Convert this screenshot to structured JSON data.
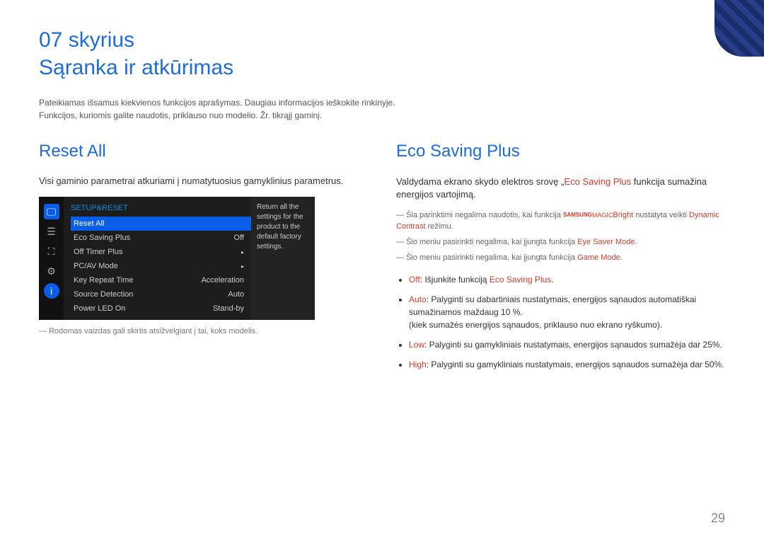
{
  "chapter": "07 skyrius",
  "title": "Sąranka ir atkūrimas",
  "intro1": "Pateikiamas išsamus kiekvienos funkcijos aprašymas. Daugiau informacijos ieškokite rinkinyje.",
  "intro2": "Funkcijos, kuriomis galite naudotis, priklauso nuo modelio. Žr. tikrąjį gaminį.",
  "reset": {
    "heading": "Reset All",
    "desc": "Visi gaminio parametrai atkuriami į numatytuosius gamyklinius parametrus.",
    "menuHeader": "SETUP&RESET",
    "items": [
      {
        "label": "Reset All",
        "value": ""
      },
      {
        "label": "Eco Saving Plus",
        "value": "Off"
      },
      {
        "label": "Off Timer Plus",
        "value": "▸"
      },
      {
        "label": "PC/AV Mode",
        "value": "▸"
      },
      {
        "label": "Key Repeat Time",
        "value": "Acceleration"
      },
      {
        "label": "Source Detection",
        "value": "Auto"
      },
      {
        "label": "Power LED On",
        "value": "Stand-by"
      }
    ],
    "rightText": "Return all the settings for the product to the default factory settings.",
    "footnote": "Rodomas vaizdas gali skirtis atsižvelgiant į tai, koks modelis."
  },
  "eco": {
    "heading": "Eco Saving Plus",
    "descPrefix": "Valdydama ekrano skydo elektros srovę „",
    "descRed": "Eco Saving Plus",
    "descSuffix": " funkcija sumažina energijos vartojimą.",
    "note1a": "Šia parinktimi negalima naudotis, kai funkcija ",
    "note1brand1": "SAMSUNG",
    "note1brand2": "MAGIC",
    "note1b": "Bright",
    "note1c": " nustatyta veikti ",
    "note1d": "Dynamic Contrast",
    "note1e": " režimu.",
    "note2a": "Šio meniu pasirinkti negalima, kai įjungta funkcija ",
    "note2b": "Eye Saver Mode",
    "note3a": "Šio meniu pasirinkti negalima, kai įjungta funkcija ",
    "note3b": "Game Mode",
    "b1a": "Off",
    "b1b": ": Išjunkite funkciją ",
    "b1c": "Eco Saving Plus",
    "b2a": "Auto",
    "b2b": ": Palyginti su dabartiniais nustatymais, energijos sąnaudos automatiškai sumažinamos maždaug 10 %.",
    "b2c": "(kiek sumažės energijos sąnaudos, priklauso nuo ekrano ryškumo).",
    "b3a": "Low",
    "b3b": ": Palyginti su gamykliniais nustatymais, energijos sąnaudos sumažėja dar 25%.",
    "b4a": "High",
    "b4b": ": Palyginti su gamykliniais nustatymais, energijos sąnaudos sumažėja dar 50%."
  },
  "pageNum": "29"
}
